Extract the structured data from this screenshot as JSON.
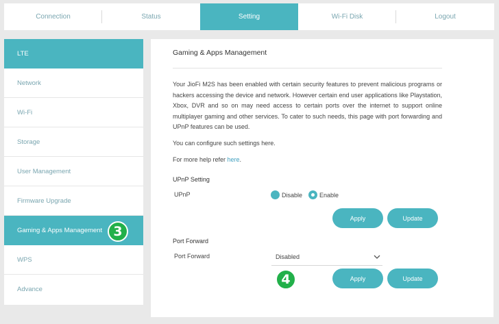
{
  "nav": {
    "tabs": [
      "Connection",
      "Status",
      "Setting",
      "Wi-Fi Disk",
      "Logout"
    ],
    "active": "Setting"
  },
  "sidebar": {
    "items": [
      "LTE",
      "Network",
      "Wi-Fi",
      "Storage",
      "User Management",
      "Firmware Upgrade",
      "Gaming & Apps Management",
      "WPS",
      "Advance"
    ],
    "active": "Gaming & Apps Management"
  },
  "badges": {
    "step3": "3",
    "step4": "4",
    "color": "#22b04a"
  },
  "main": {
    "title": "Gaming & Apps Management",
    "description": "Your JioFi M2S has been enabled with certain security features to prevent malicious programs or hackers accessing the device and network. However certain end user applications like Playstation, Xbox, DVR and so on may need access to certain ports over the internet to support online multiplayer gaming and other services. To cater to such needs, this page with port forwarding and UPnP features can be used.",
    "configure_text": "You can configure such settings here.",
    "help_prefix": "For more help refer ",
    "help_link": "here",
    "help_suffix": ".",
    "upnp": {
      "section_title": "UPnP Setting",
      "label": "UPnP",
      "options": [
        "Disable",
        "Enable"
      ],
      "selected": "Enable",
      "apply_label": "Apply",
      "update_label": "Update"
    },
    "port_forward": {
      "section_title": "Port Forward",
      "label": "Port Forward",
      "value": "Disabled",
      "apply_label": "Apply",
      "update_label": "Update"
    }
  },
  "colors": {
    "accent": "#4ab5c0",
    "text_muted": "#7aa6b0",
    "link": "#3f9fbf"
  }
}
